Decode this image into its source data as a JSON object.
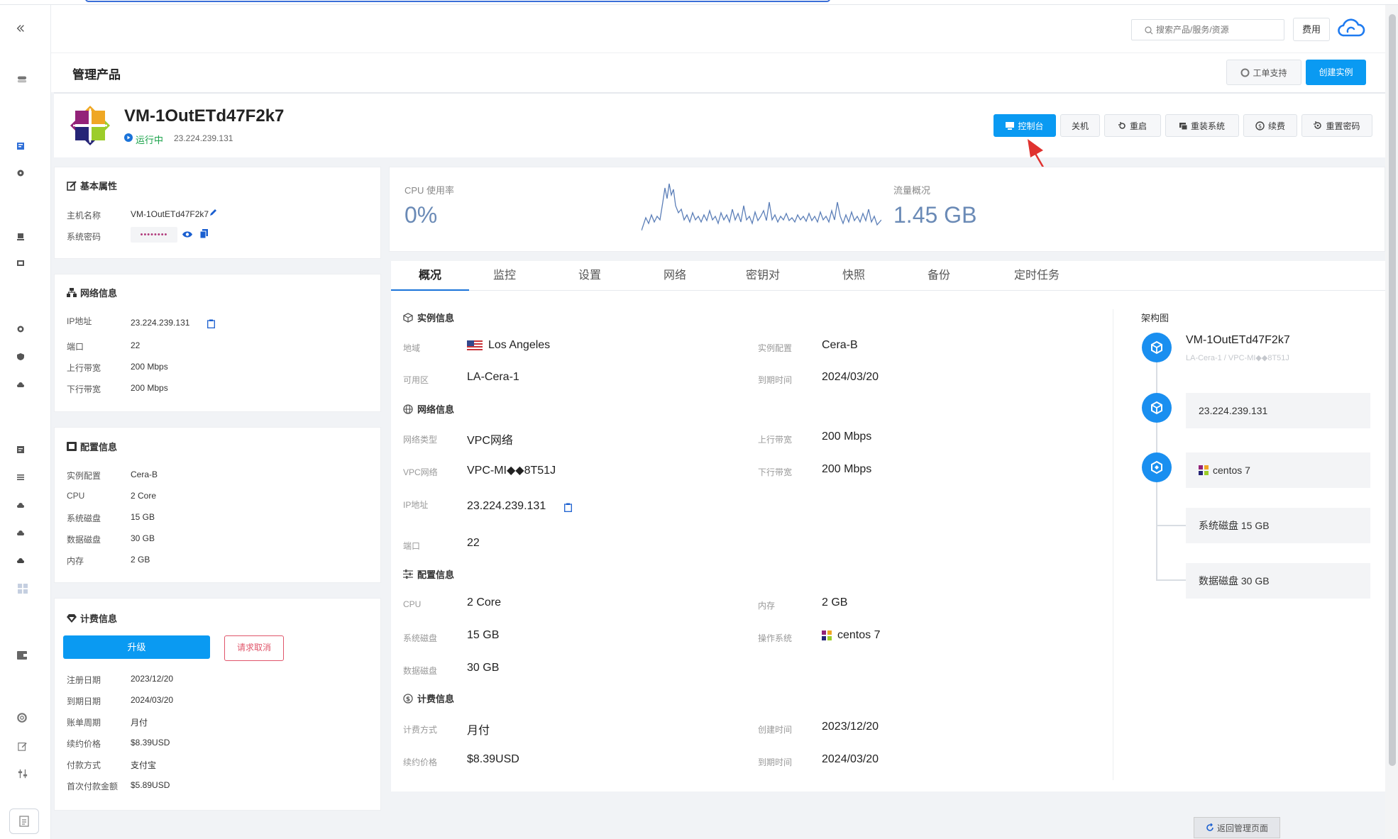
{
  "header": {
    "search_placeholder": "搜索产品/服务/资源",
    "fee_label": "费用",
    "page_title": "管理产品",
    "support_label": "工单支持",
    "create_label": "创建实例"
  },
  "instance": {
    "name": "VM-1OutETd47F2k7",
    "status": "运行中",
    "ip": "23.224.239.131",
    "actions": [
      "控制台",
      "关机",
      "重启",
      "重装系统",
      "续费",
      "重置密码"
    ]
  },
  "basic": {
    "title": "基本属性",
    "rows": [
      {
        "k": "主机名称",
        "v": "VM-1OutETd47F2k7"
      },
      {
        "k": "系统密码",
        "v": "••••••••"
      }
    ]
  },
  "network": {
    "title": "网络信息",
    "rows": [
      {
        "k": "IP地址",
        "v": "23.224.239.131"
      },
      {
        "k": "端口",
        "v": "22"
      },
      {
        "k": "上行带宽",
        "v": "200 Mbps"
      },
      {
        "k": "下行带宽",
        "v": "200 Mbps"
      }
    ]
  },
  "config": {
    "title": "配置信息",
    "rows": [
      {
        "k": "实例配置",
        "v": "Cera-B"
      },
      {
        "k": "CPU",
        "v": "2 Core"
      },
      {
        "k": "系统磁盘",
        "v": "15 GB"
      },
      {
        "k": "数据磁盘",
        "v": "30 GB"
      },
      {
        "k": "内存",
        "v": "2 GB"
      }
    ]
  },
  "billing": {
    "title": "计费信息",
    "upgrade_label": "升级",
    "cancel_label": "请求取消",
    "rows": [
      {
        "k": "注册日期",
        "v": "2023/12/20"
      },
      {
        "k": "到期日期",
        "v": "2024/03/20"
      },
      {
        "k": "账单周期",
        "v": "月付"
      },
      {
        "k": "续约价格",
        "v": "$8.39USD"
      },
      {
        "k": "付款方式",
        "v": "支付宝"
      },
      {
        "k": "首次付款金额",
        "v": "$5.89USD"
      }
    ]
  },
  "metrics": {
    "cpu_label": "CPU 使用率",
    "cpu_value": "0%",
    "traffic_label": "流量概况",
    "traffic_value": "1.45 GB"
  },
  "tabs": [
    "概况",
    "监控",
    "设置",
    "网络",
    "密钥对",
    "快照",
    "备份",
    "定时任务"
  ],
  "overview": {
    "instance_title": "实例信息",
    "network_title": "网络信息",
    "config_title": "配置信息",
    "billing_title": "计费信息",
    "region_k": "地域",
    "region_v": "Los Angeles",
    "inst_conf_k": "实例配置",
    "inst_conf_v": "Cera-B",
    "zone_k": "可用区",
    "zone_v": "LA-Cera-1",
    "expire_k": "到期时间",
    "expire_v": "2024/03/20",
    "net_type_k": "网络类型",
    "net_type_v": "VPC网络",
    "up_k": "上行带宽",
    "up_v": "200 Mbps",
    "vpc_k": "VPC网络",
    "vpc_v": "VPC-MI◆◆8T51J",
    "down_k": "下行带宽",
    "down_v": "200 Mbps",
    "ip_k": "IP地址",
    "ip_v": "23.224.239.131",
    "port_k": "端口",
    "port_v": "22",
    "cpu_k": "CPU",
    "cpu_v": "2 Core",
    "mem_k": "内存",
    "mem_v": "2 GB",
    "sysdisk_k": "系统磁盘",
    "sysdisk_v": "15 GB",
    "os_k": "操作系统",
    "os_v": "centos 7",
    "datadisk_k": "数据磁盘",
    "datadisk_v": "30 GB",
    "pay_k": "计费方式",
    "pay_v": "月付",
    "created_k": "创建时间",
    "created_v": "2023/12/20",
    "renew_k": "续约价格",
    "renew_v": "$8.39USD",
    "expire2_k": "到期时间",
    "expire2_v": "2024/03/20"
  },
  "architecture": {
    "title": "架构图",
    "name": "VM-1OutETd47F2k7",
    "sub": "LA-Cera-1 / VPC-MI◆◆8T51J",
    "ip": "23.224.239.131",
    "os": "centos 7",
    "sysdisk": "系统磁盘 15 GB",
    "datadisk": "数据磁盘 30 GB"
  },
  "footer": {
    "back_label": "返回管理页面"
  },
  "colors": {
    "primary": "#0a9af2",
    "running": "#1aa34a",
    "arrow": "#e0322f"
  }
}
